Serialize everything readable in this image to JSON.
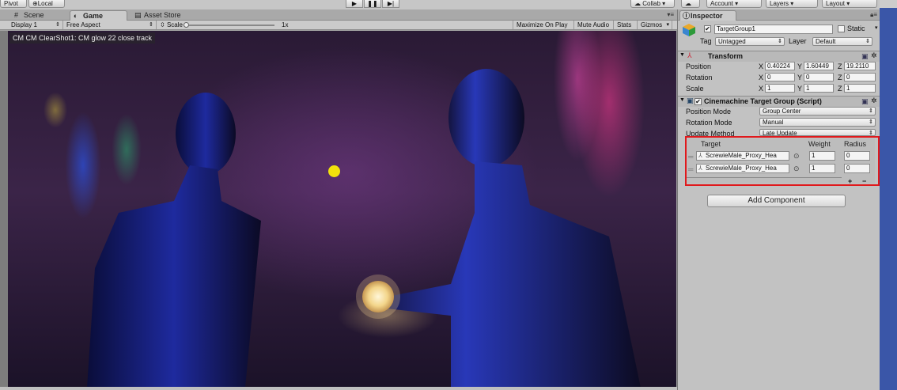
{
  "toolbar": {
    "pivot_label": "Pivot",
    "local_label": "Local",
    "collab_label": "Collab",
    "account_label": "Account",
    "layers_label": "Layers",
    "layout_label": "Layout"
  },
  "game_panel": {
    "tabs": [
      {
        "label": "Scene",
        "icon": "grid-icon"
      },
      {
        "label": "Game",
        "icon": "pacman-icon"
      },
      {
        "label": "Asset Store",
        "icon": "store-icon"
      }
    ],
    "display_label": "Display 1",
    "aspect_label": "Free Aspect",
    "scale_label": "Scale",
    "scale_value": "1x",
    "maximize_label": "Maximize On Play",
    "mute_label": "Mute Audio",
    "stats_label": "Stats",
    "gizmos_label": "Gizmos",
    "overlay_text": "CM CM ClearShot1: CM glow 22 close track"
  },
  "inspector": {
    "tab_label": "Inspector",
    "object_name": "TargetGroup1",
    "static_label": "Static",
    "tag_label": "Tag",
    "tag_value": "Untagged",
    "layer_label": "Layer",
    "layer_value": "Default",
    "transform": {
      "title": "Transform",
      "position_label": "Position",
      "rotation_label": "Rotation",
      "scale_label": "Scale",
      "position": {
        "x": "0.40224",
        "y": "1.60449",
        "z": "19.2110"
      },
      "rotation": {
        "x": "0",
        "y": "0",
        "z": "0"
      },
      "scale": {
        "x": "1",
        "y": "1",
        "z": "1"
      }
    },
    "target_group": {
      "title": "Cinemachine Target Group (Script)",
      "position_mode_label": "Position Mode",
      "position_mode_value": "Group Center",
      "rotation_mode_label": "Rotation Mode",
      "rotation_mode_value": "Manual",
      "update_method_label": "Update Method",
      "update_method_value": "Late Update",
      "col_target": "Target",
      "col_weight": "Weight",
      "col_radius": "Radius",
      "targets": [
        {
          "name": "ScrewieMale_Proxy_Hea",
          "weight": "1",
          "radius": "0"
        },
        {
          "name": "ScrewieMale_Proxy_Hea",
          "weight": "1",
          "radius": "0"
        }
      ],
      "add_symbol": "+",
      "remove_symbol": "−"
    },
    "add_component_label": "Add Component"
  },
  "colors": {
    "highlight_box": "#e0191c",
    "yellow_marker": "#f2e20c"
  }
}
